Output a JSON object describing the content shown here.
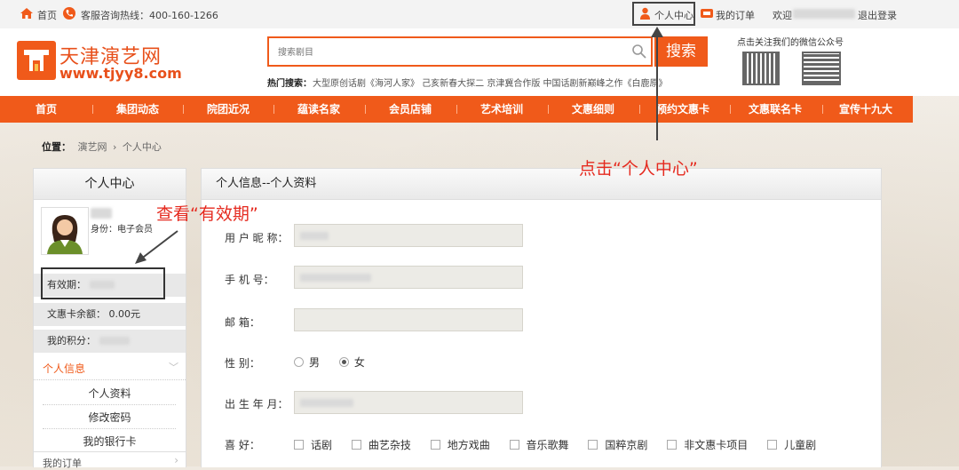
{
  "topbar": {
    "home": "首页",
    "hotline": "客服咨询热线：400-160-1266",
    "user_center": "个人中心",
    "my_orders": "我的订单",
    "welcome": "欢迎",
    "logout": "退出登录"
  },
  "logo": {
    "name": "天津演艺网",
    "url": "www.tjyy8.com"
  },
  "search": {
    "placeholder": "搜索剧目",
    "button": "搜索",
    "hot_label": "热门搜索：",
    "hot_items": "大型原创话剧《海河人家》  己亥新春大探二 京津冀合作版  中国话剧新巅峰之作《白鹿原》"
  },
  "wechat": {
    "label": "点击关注我们的微信公众号"
  },
  "nav": [
    "首页",
    "集团动态",
    "院团近况",
    "蕴读名家",
    "会员店铺",
    "艺术培训",
    "文惠细则",
    "预约文惠卡",
    "文惠联名卡",
    "宣传十九大"
  ],
  "breadcrumb": {
    "label": "位置：",
    "home": "演艺网",
    "sep": "›",
    "current": "个人中心"
  },
  "sidebar": {
    "title": "个人中心",
    "identity": "身份：电子会员",
    "validity": "有效期：",
    "card_balance": "文惠卡余额：  0.00元",
    "points": "我的积分：",
    "section": "个人信息",
    "items": [
      "个人资料",
      "修改密码",
      "我的银行卡"
    ],
    "orders": "我的订单"
  },
  "main": {
    "title": "个人信息--个人资料",
    "fields": {
      "nickname": "用 户 昵 称：",
      "phone": "手   机   号：",
      "email": "邮          箱：",
      "gender": "性          别：",
      "birth": "出 生 年 月：",
      "hobby": "喜          好："
    },
    "gender_options": [
      "男",
      "女"
    ],
    "gender_selected": "女",
    "hobbies": [
      "话剧",
      "曲艺杂技",
      "地方戏曲",
      "音乐歌舞",
      "国粹京剧",
      "非文惠卡项目",
      "儿童剧"
    ]
  },
  "annotations": {
    "click_center": "点击“个人中心”",
    "view_validity": "查看“有效期”"
  },
  "colors": {
    "accent": "#f05a1a",
    "annotation": "#e52a1f"
  }
}
